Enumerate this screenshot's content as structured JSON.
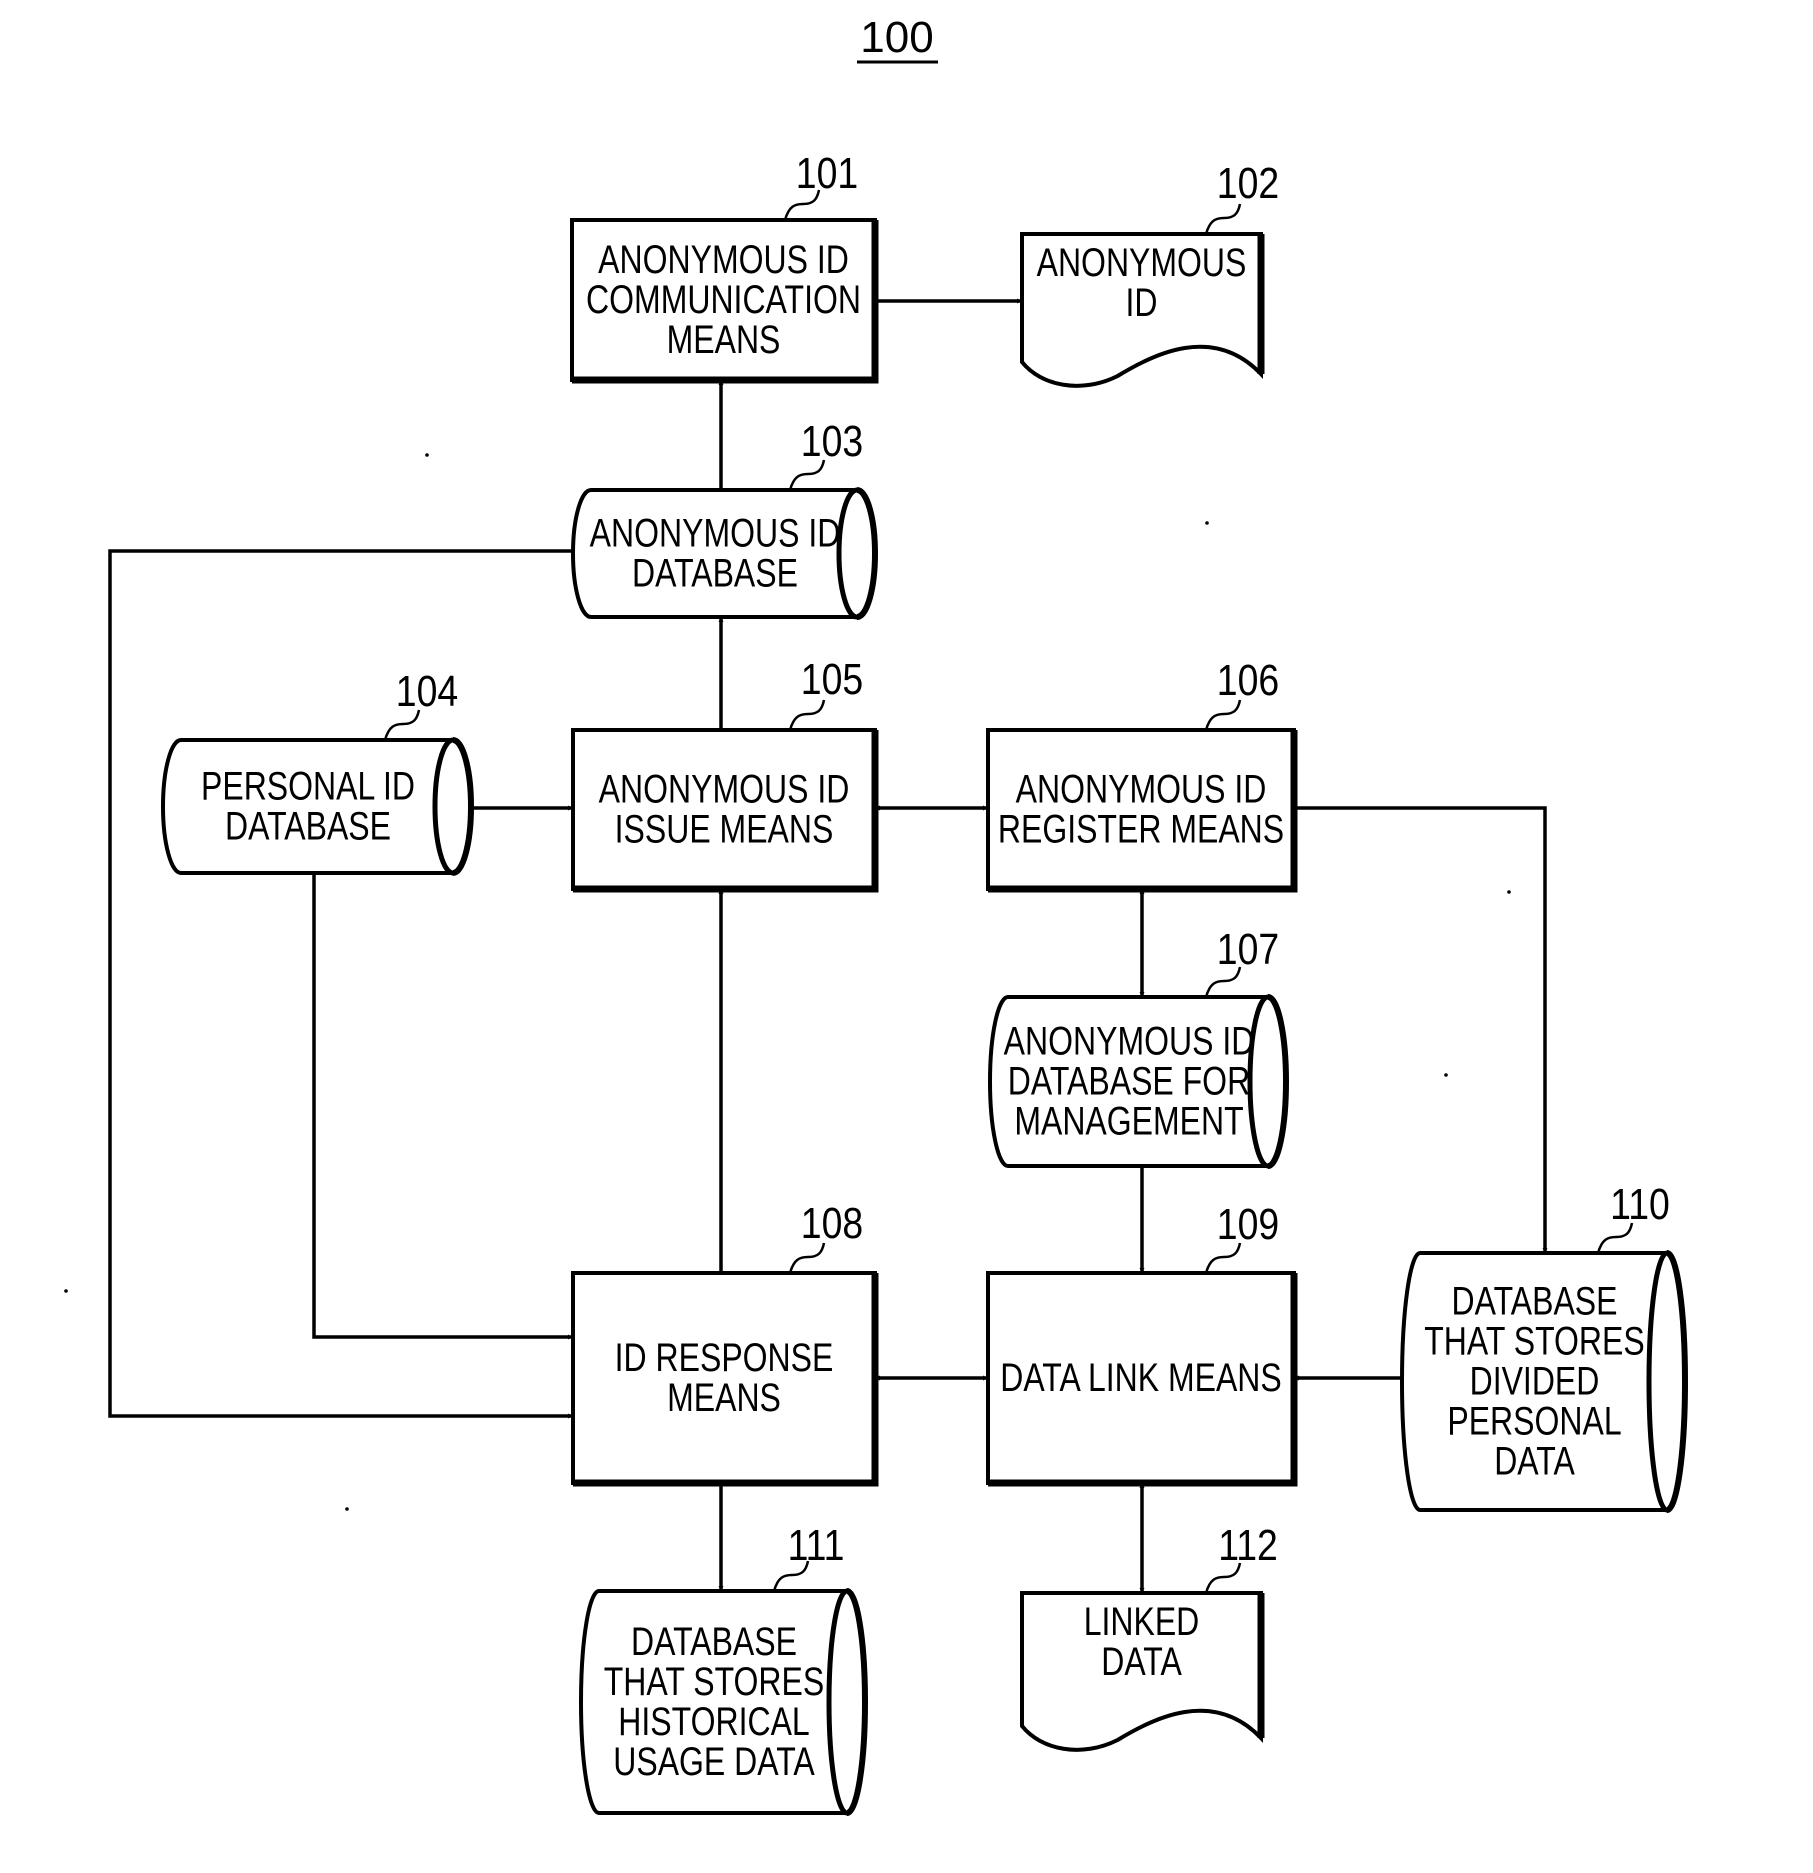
{
  "figure": {
    "title": "100",
    "colors": {
      "ink": "#000000",
      "paper": "#ffffff"
    }
  },
  "nodes": [
    {
      "id": "101",
      "type": "process",
      "lines": [
        "ANONYMOUS ID",
        "COMMUNICATION",
        "MEANS"
      ]
    },
    {
      "id": "102",
      "type": "document",
      "lines": [
        "ANONYMOUS",
        "ID"
      ]
    },
    {
      "id": "103",
      "type": "database",
      "lines": [
        "ANONYMOUS ID",
        "DATABASE"
      ]
    },
    {
      "id": "104",
      "type": "database",
      "lines": [
        "PERSONAL ID",
        "DATABASE"
      ]
    },
    {
      "id": "105",
      "type": "process",
      "lines": [
        "ANONYMOUS ID",
        "ISSUE MEANS"
      ]
    },
    {
      "id": "106",
      "type": "process",
      "lines": [
        "ANONYMOUS ID",
        "REGISTER MEANS"
      ]
    },
    {
      "id": "107",
      "type": "database",
      "lines": [
        "ANONYMOUS ID",
        "DATABASE FOR",
        "MANAGEMENT"
      ]
    },
    {
      "id": "108",
      "type": "process",
      "lines": [
        "ID RESPONSE",
        "MEANS"
      ]
    },
    {
      "id": "109",
      "type": "process",
      "lines": [
        "DATA LINK MEANS"
      ]
    },
    {
      "id": "110",
      "type": "database",
      "lines": [
        "DATABASE",
        "THAT STORES",
        "DIVIDED",
        "PERSONAL",
        "DATA"
      ]
    },
    {
      "id": "111",
      "type": "database",
      "lines": [
        "DATABASE",
        "THAT STORES",
        "HISTORICAL",
        "USAGE DATA"
      ]
    },
    {
      "id": "112",
      "type": "document",
      "lines": [
        "LINKED",
        "DATA"
      ]
    }
  ],
  "edges": [
    {
      "from": "101",
      "to": "102",
      "direction": "forward"
    },
    {
      "from": "103",
      "to": "101",
      "direction": "forward"
    },
    {
      "from": "105",
      "to": "103",
      "direction": "forward"
    },
    {
      "from": "104",
      "to": "105",
      "direction": "forward"
    },
    {
      "from": "105",
      "to": "106",
      "direction": "both"
    },
    {
      "from": "106",
      "to": "110",
      "direction": "forward"
    },
    {
      "from": "106",
      "to": "107",
      "direction": "both"
    },
    {
      "from": "107",
      "to": "109",
      "direction": "forward"
    },
    {
      "from": "108",
      "to": "105",
      "direction": "forward"
    },
    {
      "from": "104",
      "to": "108",
      "direction": "forward"
    },
    {
      "from": "103",
      "to": "108",
      "direction": "forward"
    },
    {
      "from": "108",
      "to": "109",
      "direction": "both"
    },
    {
      "from": "110",
      "to": "109",
      "direction": "forward"
    },
    {
      "from": "108",
      "to": "111",
      "direction": "forward"
    },
    {
      "from": "109",
      "to": "112",
      "direction": "both"
    }
  ]
}
